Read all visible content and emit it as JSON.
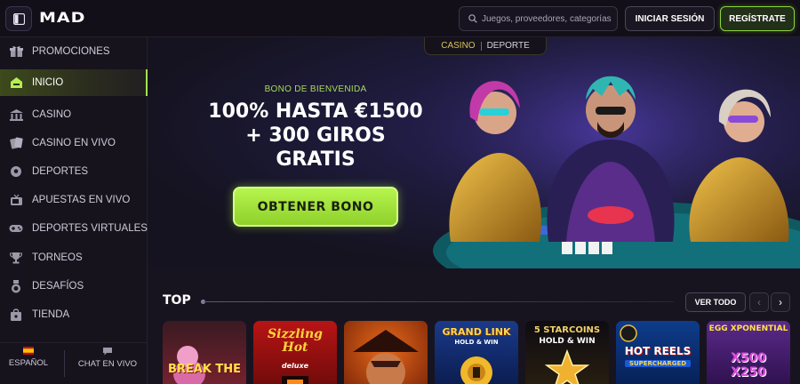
{
  "brand": {
    "logo": "MAD"
  },
  "header": {
    "search_placeholder": "Juegos, proveedores, categorías",
    "login_label": "INICIAR SESIÓN",
    "register_label": "REGÍSTRATE"
  },
  "sidebar": {
    "items": [
      {
        "label": "PROMOCIONES",
        "icon": "gift-icon"
      },
      {
        "label": "INICIO",
        "icon": "home-icon",
        "active": true
      },
      {
        "label": "CASINO",
        "icon": "casino-icon"
      },
      {
        "label": "CASINO EN VIVO",
        "icon": "cards-icon"
      },
      {
        "label": "DEPORTES",
        "icon": "soccer-ball-icon"
      },
      {
        "label": "APUESTAS EN VIVO",
        "icon": "tv-icon"
      },
      {
        "label": "DEPORTES VIRTUALES",
        "icon": "gamepad-icon"
      },
      {
        "label": "TORNEOS",
        "icon": "trophy-icon"
      },
      {
        "label": "DESAFÍOS",
        "icon": "medal-icon"
      },
      {
        "label": "TIENDA",
        "icon": "shop-bag-icon"
      }
    ],
    "footer": {
      "language_label": "ESPAÑOL",
      "chat_label": "CHAT EN VIVO"
    }
  },
  "hero": {
    "tabs": [
      {
        "label": "CASINO",
        "active": true
      },
      {
        "label": "DEPORTE",
        "active": false
      }
    ],
    "subtitle": "BONO DE BIENVENIDA",
    "title_line1": "100% HASTA €1500",
    "title_line2": "+ 300 GIROS",
    "title_line3": "GRATIS",
    "cta_label": "OBTENER BONO"
  },
  "top_section": {
    "title": "TOP",
    "view_all_label": "VER TODO",
    "games": [
      {
        "name": "BREAK THE",
        "bg": "#6b1f2a"
      },
      {
        "name": "Sizzling Hot",
        "sub": "deluxe",
        "bg": "#8a1313"
      },
      {
        "name": "",
        "bg": "#9a3a10"
      },
      {
        "name": "GRAND LINK",
        "sub": "HOLD & WIN",
        "bg": "#1b3a7a"
      },
      {
        "name": "5 STARCOINS",
        "sub": "HOLD & WIN",
        "bg": "#120f14"
      },
      {
        "name": "HOT REELS",
        "sub": "SUPERCHARGED",
        "bg": "#0e3c8a"
      },
      {
        "name": "EGG XPONENTIAL",
        "sub": "X500  X250",
        "bg": "#3a1656"
      }
    ]
  },
  "colors": {
    "accent_green": "#a2e34a",
    "gold": "#d7c25d",
    "background": "#17141f"
  }
}
